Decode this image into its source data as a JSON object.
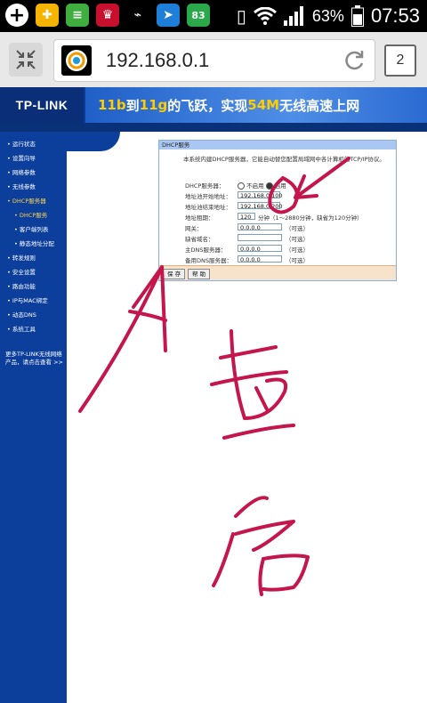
{
  "status_bar": {
    "battery_percent": "63%",
    "time": "07:53",
    "app_icons": [
      "plus-icon",
      "shield-app-icon",
      "reader-app-icon",
      "game-app-icon",
      "usb-icon",
      "pin-app-icon",
      "sms-app-icon"
    ],
    "system_icons": [
      "vibrate-icon",
      "wifi-icon",
      "signal-icon",
      "battery-icon"
    ]
  },
  "browser": {
    "url": "192.168.0.1",
    "tab_count": "2"
  },
  "router": {
    "logo": "TP-LINK",
    "slogan": {
      "part1": "11b",
      "part2": "到",
      "part3": "11g",
      "part4": "的飞跃，实现",
      "part5": "54M",
      "part6": "无线高速上网"
    },
    "sidebar": {
      "items": [
        {
          "label": "• 运行状态"
        },
        {
          "label": "• 设置向导"
        },
        {
          "label": "• 网络参数"
        },
        {
          "label": "• 无线参数"
        },
        {
          "label": "• DHCP服务器",
          "active": true
        },
        {
          "label": "• DHCP服务",
          "sub": true,
          "active": true
        },
        {
          "label": "• 客户端列表",
          "sub": true
        },
        {
          "label": "• 静态地址分配",
          "sub": true
        },
        {
          "label": "• 转发规则"
        },
        {
          "label": "• 安全设置"
        },
        {
          "label": "• 路由功能"
        },
        {
          "label": "• IP与MAC绑定"
        },
        {
          "label": "• 动态DNS"
        },
        {
          "label": "• 系统工具"
        }
      ],
      "more": "更多TP-LINK无线网络产品，请点击查看 >>"
    },
    "dhcp": {
      "title": "DHCP服务",
      "description": "本系统内建DHCP服务器，它能自动替您配置局域网中各计算机的TCP/IP协议。",
      "server_label": "DHCP服务器：",
      "disable_label": "不启用",
      "enable_label": "启用",
      "start_label": "地址池开始地址：",
      "start_value": "192.168.0.100",
      "end_label": "地址池结束地址：",
      "end_value": "192.168.0.200",
      "lease_label": "地址租期：",
      "lease_value": "120",
      "lease_hint": "分钟（1～2880分钟，缺省为120分钟）",
      "gateway_label": "网关：",
      "gateway_value": "0.0.0.0",
      "domain_label": "缺省域名：",
      "domain_value": "",
      "dns1_label": "主DNS服务器：",
      "dns1_value": "0.0.0.0",
      "dns2_label": "备用DNS服务器：",
      "dns2_value": "0.0.0.0",
      "optional": "（可选）",
      "save": "保 存",
      "help": "帮 助"
    }
  },
  "annotation": {
    "handwriting": "重启",
    "ink_color": "#c4164d"
  }
}
